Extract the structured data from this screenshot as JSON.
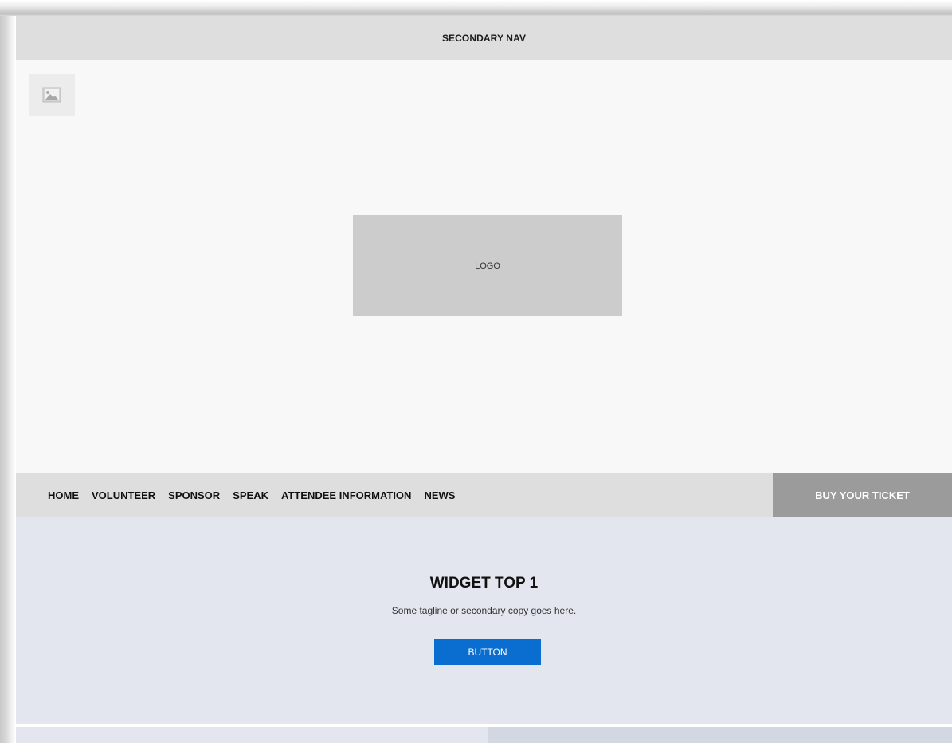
{
  "secondary_nav": {
    "label": "SECONDARY NAV"
  },
  "hero": {
    "image_icon": "image-placeholder-icon",
    "logo_label": "LOGO"
  },
  "main_nav": {
    "items": [
      {
        "label": "HOME"
      },
      {
        "label": "VOLUNTEER"
      },
      {
        "label": "SPONSOR"
      },
      {
        "label": "SPEAK"
      },
      {
        "label": "ATTENDEE INFORMATION"
      },
      {
        "label": "NEWS"
      }
    ],
    "cta_label": "BUY YOUR TICKET"
  },
  "widget_top": {
    "title": "WIDGET TOP 1",
    "tagline": "Some tagline or secondary copy goes here.",
    "button_label": "BUTTON"
  },
  "colors": {
    "accent_button": "#0a6ed1",
    "cta_background": "#9b9b9b",
    "nav_background": "#dedede",
    "widget_background": "#e3e6ef"
  }
}
